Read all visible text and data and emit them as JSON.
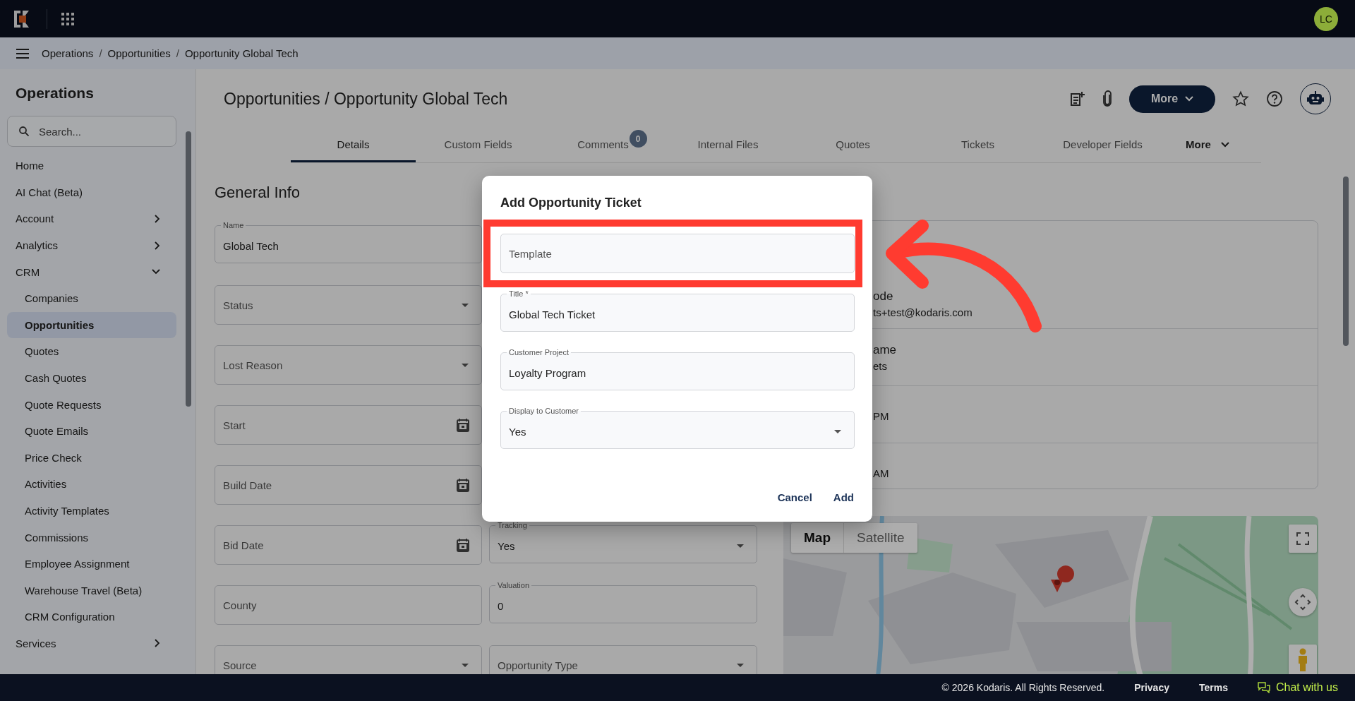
{
  "top_bar": {
    "avatar": "LC"
  },
  "breadcrumb": {
    "items": [
      "Operations",
      "Opportunities",
      "Opportunity Global Tech"
    ],
    "separator": "/"
  },
  "sidebar": {
    "title": "Operations",
    "search": {
      "placeholder": "Search..."
    },
    "items": [
      {
        "label": "Home",
        "selected": false
      },
      {
        "label": "AI Chat (Beta)",
        "selected": false
      },
      {
        "label": "Account",
        "selected": false,
        "expanded": false
      },
      {
        "label": "Analytics",
        "selected": false,
        "expanded": false
      },
      {
        "label": "CRM",
        "selected": false,
        "expanded": true,
        "children": [
          {
            "label": "Companies",
            "selected": false
          },
          {
            "label": "Opportunities",
            "selected": true
          },
          {
            "label": "Quotes",
            "selected": false
          },
          {
            "label": "Cash Quotes",
            "selected": false
          },
          {
            "label": "Quote Requests",
            "selected": false
          },
          {
            "label": "Quote Emails",
            "selected": false
          },
          {
            "label": "Price Check",
            "selected": false
          },
          {
            "label": "Activities",
            "selected": false
          },
          {
            "label": "Activity Templates",
            "selected": false
          },
          {
            "label": "Commissions",
            "selected": false
          },
          {
            "label": "Employee Assignment",
            "selected": false
          },
          {
            "label": "Warehouse Travel (Beta)",
            "selected": false
          },
          {
            "label": "CRM Configuration",
            "selected": false
          }
        ]
      },
      {
        "label": "Services",
        "selected": false,
        "expanded": false
      }
    ]
  },
  "page": {
    "title": "Opportunities / Opportunity Global Tech",
    "more_button": "More",
    "tabs": [
      {
        "label": "Details",
        "selected": true
      },
      {
        "label": "Custom Fields",
        "selected": false
      },
      {
        "label": "Comments",
        "selected": false,
        "badge": "0"
      },
      {
        "label": "Internal Files",
        "selected": false
      },
      {
        "label": "Quotes",
        "selected": false
      },
      {
        "label": "Tickets",
        "selected": false
      },
      {
        "label": "Developer Fields",
        "selected": false
      },
      {
        "label": "More",
        "selected": false,
        "kind": "menu"
      }
    ]
  },
  "general_info": {
    "heading": "General Info",
    "left_fields": [
      {
        "label": "Name",
        "value": "Global Tech",
        "kind": "text"
      },
      {
        "label": "Status",
        "kind": "select"
      },
      {
        "label": "Lost Reason",
        "kind": "select"
      },
      {
        "label": "Start",
        "kind": "date"
      },
      {
        "label": "Build Date",
        "kind": "date"
      },
      {
        "label": "Bid Date",
        "kind": "date"
      },
      {
        "label": "County",
        "kind": "text"
      },
      {
        "label": "Source",
        "kind": "select"
      }
    ],
    "right_fields": [
      {
        "label": "Tracking",
        "value": "Yes",
        "kind": "select"
      },
      {
        "label": "Valuation",
        "value": "0",
        "kind": "text"
      },
      {
        "label": "Opportunity Type",
        "kind": "select"
      }
    ]
  },
  "details_card": {
    "rows": [
      {
        "label": "ode",
        "value": "ts+test@kodaris.com"
      },
      {
        "label": "ame",
        "value": "ets"
      },
      {
        "value": "PM"
      },
      {
        "value": "AM"
      }
    ]
  },
  "map": {
    "kind": "picture",
    "map_types": [
      {
        "label": "Map",
        "selected": true
      },
      {
        "label": "Satellite",
        "selected": false
      }
    ]
  },
  "dialog": {
    "title": "Add Opportunity Ticket",
    "fields": [
      {
        "label": "Template",
        "kind": "text"
      },
      {
        "label": "Title *",
        "value": "Global Tech Ticket",
        "kind": "text"
      },
      {
        "label": "Customer Project",
        "value": "Loyalty Program",
        "kind": "text"
      },
      {
        "label": "Display to Customer",
        "value": "Yes",
        "kind": "select"
      }
    ],
    "buttons": [
      "Cancel",
      "Add"
    ]
  },
  "footer": {
    "copyright": "© 2026 Kodaris. All Rights Reserved.",
    "links": [
      "Privacy",
      "Terms"
    ],
    "chat": "Chat with us"
  }
}
